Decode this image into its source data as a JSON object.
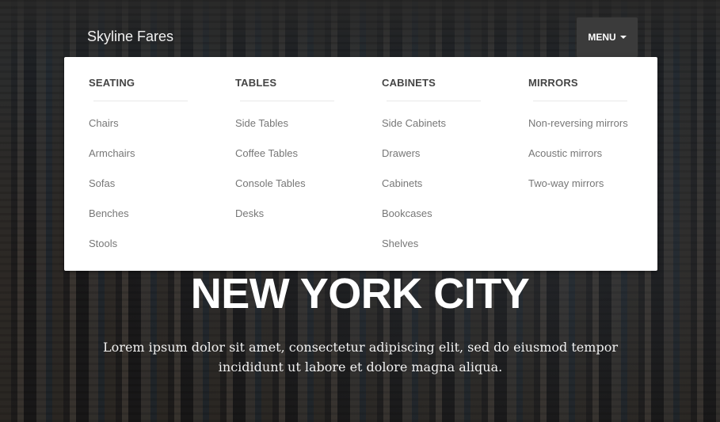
{
  "navbar": {
    "brand": "Skyline Fares",
    "menu_label": "MENU"
  },
  "dropdown": {
    "columns": [
      {
        "title": "SEATING",
        "items": [
          "Chairs",
          "Armchairs",
          "Sofas",
          "Benches",
          "Stools"
        ]
      },
      {
        "title": "TABLES",
        "items": [
          "Side Tables",
          "Coffee Tables",
          "Console Tables",
          "Desks"
        ]
      },
      {
        "title": "CABINETS",
        "items": [
          "Side Cabinets",
          "Drawers",
          "Cabinets",
          "Bookcases",
          "Shelves"
        ]
      },
      {
        "title": "MIRRORS",
        "items": [
          "Non-reversing mirrors",
          "Acoustic mirrors",
          "Two-way mirrors"
        ]
      }
    ]
  },
  "hero": {
    "title": "NEW YORK CITY",
    "text": "Lorem ipsum dolor sit amet, consectetur adipiscing elit, sed do eiusmod tempor incididunt ut labore et dolore magna aliqua."
  }
}
